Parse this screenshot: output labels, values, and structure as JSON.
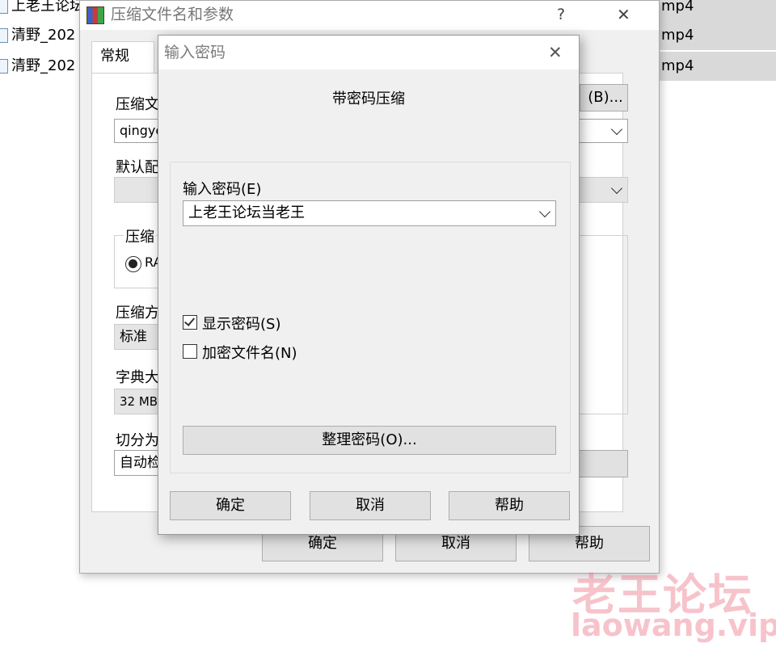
{
  "background_files": {
    "rows": [
      {
        "name": "上老王论坛",
        "ext": "mp4"
      },
      {
        "name": "清野_202",
        "ext": "mp4"
      },
      {
        "name": "清野_202",
        "ext": "mp4"
      }
    ]
  },
  "main_dialog": {
    "title": "压缩文件名和参数",
    "help_glyph": "?",
    "close_glyph": "✕",
    "tabs": {
      "general": "常规"
    },
    "archive_name_label": "压缩文",
    "archive_name_value": "qingye",
    "browse_button": "(B)...",
    "default_profile_label": "默认配",
    "format_group_label": "压缩",
    "format_radio_rar": "RA",
    "method_label": "压缩方",
    "method_value": "标准",
    "dict_label": "字典大",
    "dict_value": "32 MB",
    "split_label": "切分为",
    "split_value": "自动检",
    "right_paren": ")",
    "ok_button": "确定",
    "cancel_button": "取消",
    "help_button": "帮助"
  },
  "password_dialog": {
    "title": "输入密码",
    "close_glyph": "✕",
    "heading": "带密码压缩",
    "password_label": "输入密码(E)",
    "password_value": "上老王论坛当老王",
    "show_password_label": "显示密码(S)",
    "show_password_checked": true,
    "encrypt_filenames_label": "加密文件名(N)",
    "encrypt_filenames_checked": false,
    "organize_button": "整理密码(O)...",
    "ok_button": "确定",
    "cancel_button": "取消",
    "help_button": "帮助"
  },
  "watermark": {
    "cn": "老王论坛",
    "en": "laowang.vip"
  }
}
